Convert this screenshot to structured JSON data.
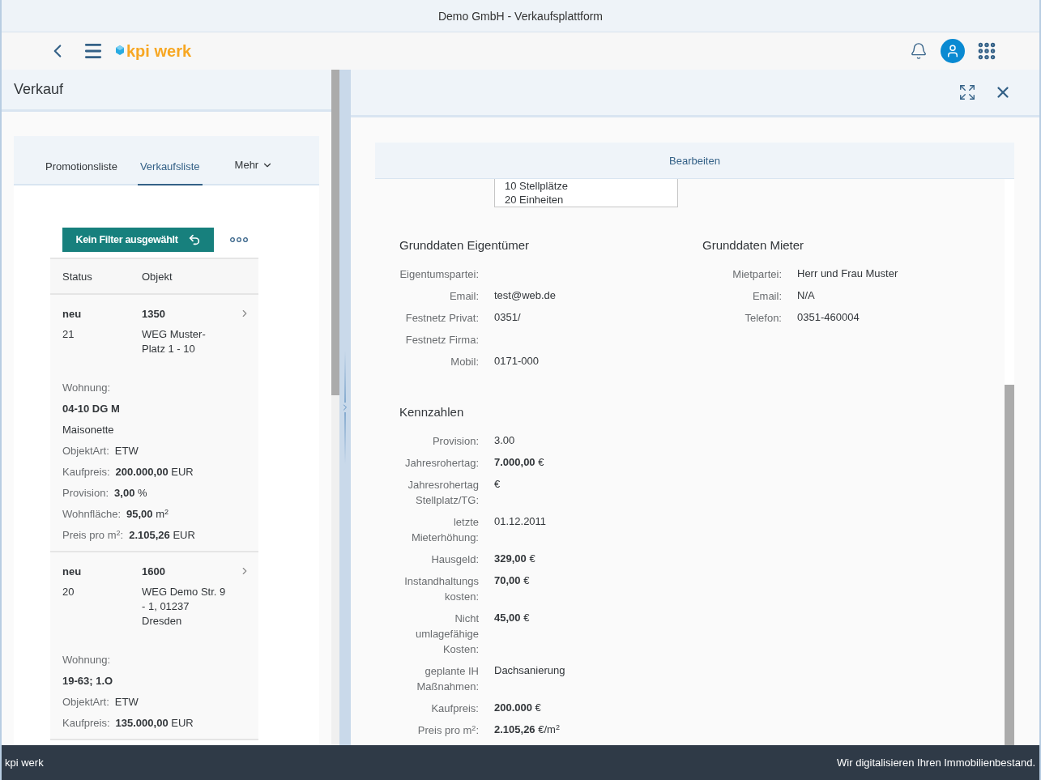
{
  "window": {
    "title": "Demo GmbH - Verkaufsplattform"
  },
  "shell": {
    "logo": "kpi werk"
  },
  "master": {
    "title": "Verkauf",
    "tabs": [
      {
        "label": "Promotionsliste",
        "selected": false
      },
      {
        "label": "Verkaufsliste",
        "selected": true
      }
    ],
    "more": "Mehr",
    "filter_button": "Kein Filter ausgewählt",
    "columns": [
      "Status",
      "Objekt"
    ],
    "items": [
      {
        "status": "neu",
        "number": "21",
        "id": "1350",
        "object": "WEG Muster-Platz 1 - 10",
        "details": [
          {
            "kind": "label",
            "text": "Wohnung:"
          },
          {
            "kind": "strong",
            "text": "04-10 DG M"
          },
          {
            "kind": "text",
            "text": "Maisonette"
          },
          {
            "kind": "pair",
            "label": "ObjektArt:",
            "value": "ETW"
          },
          {
            "kind": "pair",
            "label": "Kaufpreis:",
            "value": "**200.000,00** EUR"
          },
          {
            "kind": "pair",
            "label": "Provision:",
            "value": "**3,00** %"
          },
          {
            "kind": "pair",
            "label": "Wohnfläche:",
            "value": "**95,00** m$^{2}$"
          },
          {
            "kind": "pair",
            "label": "Preis pro m$^{2}$:",
            "value": "**2.105,26** EUR"
          }
        ]
      },
      {
        "status": "neu",
        "number": "20",
        "id": "1600",
        "object": "WEG Demo Str. 9 - 1, 01237 Dresden",
        "details": [
          {
            "kind": "label",
            "text": "Wohnung:"
          },
          {
            "kind": "strong",
            "text": "19-63; 1.O"
          },
          {
            "kind": "pair",
            "label": "ObjektArt:",
            "value": "ETW"
          },
          {
            "kind": "pair",
            "label": "Kaufpreis:",
            "value": "**135.000,00** EUR"
          }
        ]
      }
    ]
  },
  "detail": {
    "toolbar_button": "Bearbeiten",
    "fragment": [
      "10 Stellplätze",
      "20 Einheiten"
    ],
    "owner": {
      "title": "Grunddaten Eigentümer",
      "fields": [
        {
          "label": "Eigentumspartei:"
        },
        {
          "label": "Email:",
          "value": "test@web.de"
        },
        {
          "label": "Festnetz Privat:",
          "value": "0351/"
        },
        {
          "label": "Festnetz Firma:"
        },
        {
          "label": "Mobil:",
          "value": "0171-000"
        }
      ]
    },
    "tenant": {
      "title": "Grunddaten Mieter",
      "fields": [
        {
          "label": "Mietpartei:",
          "value": "Herr und Frau Muster"
        },
        {
          "label": "Email:",
          "value": "N/A"
        },
        {
          "label": "Telefon:",
          "value": "0351-460004"
        }
      ]
    },
    "figures": {
      "title": "Kennzahlen",
      "fields": [
        {
          "label": "Provision:",
          "value": "3.00"
        },
        {
          "label": "Jahresrohertag:",
          "value": "**7.000,00** €"
        },
        {
          "label": "Jahresrohertag Stellplatz/TG:",
          "value": " €"
        },
        {
          "label": "letzte Mieterhöhung:",
          "value": "01.12.2011"
        },
        {
          "label": "Hausgeld:",
          "value": "**329,00** €"
        },
        {
          "label": "Instandhaltungs kosten:",
          "value": "**70,00** €"
        },
        {
          "label": "Nicht umlagefähige Kosten:",
          "value": "**45,00** €"
        },
        {
          "label": "geplante IH Maßnahmen:",
          "value": "Dachsanierung"
        },
        {
          "label": "Kaufpreis:",
          "value": "**200.000** €"
        },
        {
          "label": "Preis pro m$^{2}$:",
          "value": "**2.105,26** €/m$^{2}$"
        }
      ]
    }
  },
  "footer": {
    "left": "kpi werk",
    "right": "Wir digitalisieren Ihren Immobilienbestand."
  }
}
